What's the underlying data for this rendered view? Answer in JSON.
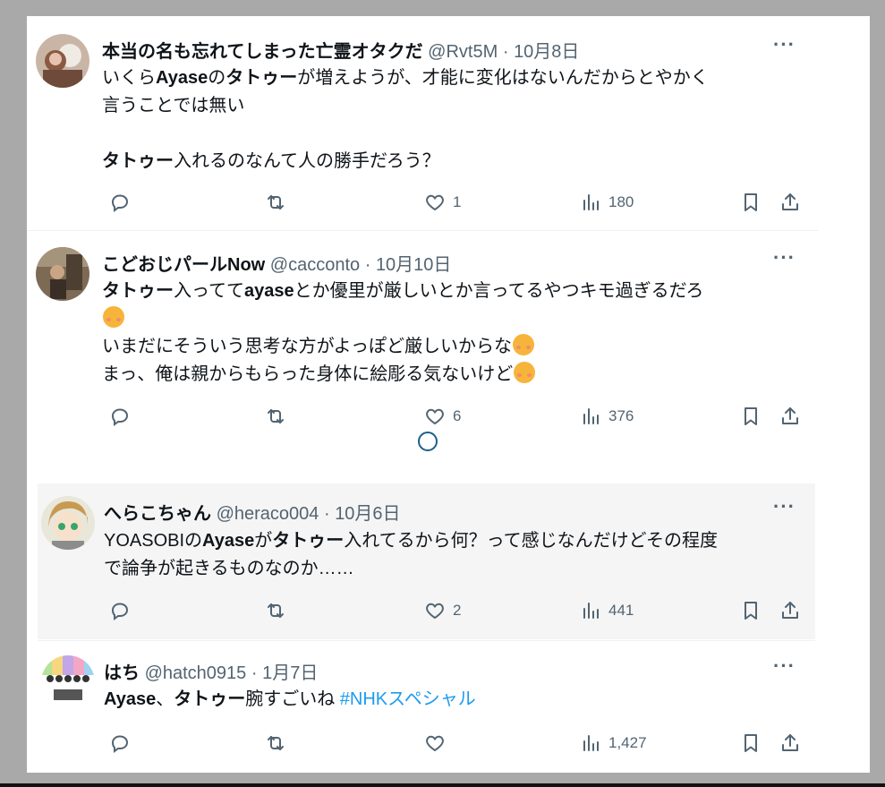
{
  "posts": [
    {
      "name": "本当の名も忘れてしまった亡霊オタクだ",
      "handle": "@Rvt5M",
      "date": "10月8日",
      "more": "···",
      "body": [
        [
          {
            "t": "いくら"
          },
          {
            "t": "Ayase",
            "b": true
          },
          {
            "t": "の"
          },
          {
            "t": "タトゥー",
            "b": true
          },
          {
            "t": "が増えようが、才能に変化はないんだからとやかく"
          }
        ],
        [
          {
            "t": "言うことでは無い"
          }
        ],
        [],
        [
          {
            "t": "タトゥー",
            "b": true
          },
          {
            "t": "入れるのなんて人の勝手だろう？"
          }
        ]
      ],
      "stats": {
        "reply": "",
        "repost": "",
        "like": "1",
        "views": "180"
      }
    },
    {
      "name": "こどおじパールNow",
      "handle": "@cacconto",
      "date": "10月10日",
      "more": "···",
      "body": [
        [
          {
            "t": "タトゥー",
            "b": true
          },
          {
            "t": "入ってて"
          },
          {
            "t": "ayase",
            "b": true
          },
          {
            "t": "とか優里が厳しいとか言ってるやつキモ過ぎるだろ"
          }
        ],
        [
          {
            "emoji": "smiling-face-emoji"
          }
        ],
        [
          {
            "t": "いまだにそういう思考な方がよっぽど厳しいからな"
          },
          {
            "emoji": "smiling-face-emoji"
          }
        ],
        [
          {
            "t": "まっ、俺は親からもらった身体に絵彫る気ないけど"
          },
          {
            "emoji": "smiling-face-emoji"
          }
        ]
      ],
      "stats": {
        "reply": "",
        "repost": "",
        "like": "6",
        "views": "376"
      }
    },
    {
      "name": "へらこちゃん",
      "handle": "@heraco004",
      "date": "10月6日",
      "more": "···",
      "body": [
        [
          {
            "t": "YOASOBIの"
          },
          {
            "t": "Ayase",
            "b": true
          },
          {
            "t": "が"
          },
          {
            "t": "タトゥー",
            "b": true
          },
          {
            "t": "入れてるから何？って感じなんだけどその程度"
          }
        ],
        [
          {
            "t": "で論争が起きるものなのか……"
          }
        ]
      ],
      "stats": {
        "reply": "",
        "repost": "",
        "like": "2",
        "views": "441"
      }
    },
    {
      "name": "はち",
      "handle": "@hatch0915",
      "date": "1月7日",
      "more": "···",
      "body": [
        [
          {
            "t": "Ayase",
            "b": true
          },
          {
            "t": "、"
          },
          {
            "t": "タトゥー",
            "b": true
          },
          {
            "t": "腕すごいね "
          },
          {
            "t": "#NHKスペシャル",
            "tag": true
          }
        ]
      ],
      "stats": {
        "reply": "",
        "repost": "",
        "like": "",
        "views": "1,427"
      }
    }
  ],
  "icons": {
    "reply": "reply-icon",
    "repost": "repost-icon",
    "like": "heart-icon",
    "views": "views-icon",
    "bookmark": "bookmark-icon",
    "share": "share-icon",
    "loading": "loading-spinner-icon"
  },
  "colors": {
    "text": "#0f1419",
    "secondary": "#536471",
    "hashtag": "#1d9bf0",
    "shaded_background": "#f5f5f5",
    "outer_background": "#a9a9a9"
  }
}
